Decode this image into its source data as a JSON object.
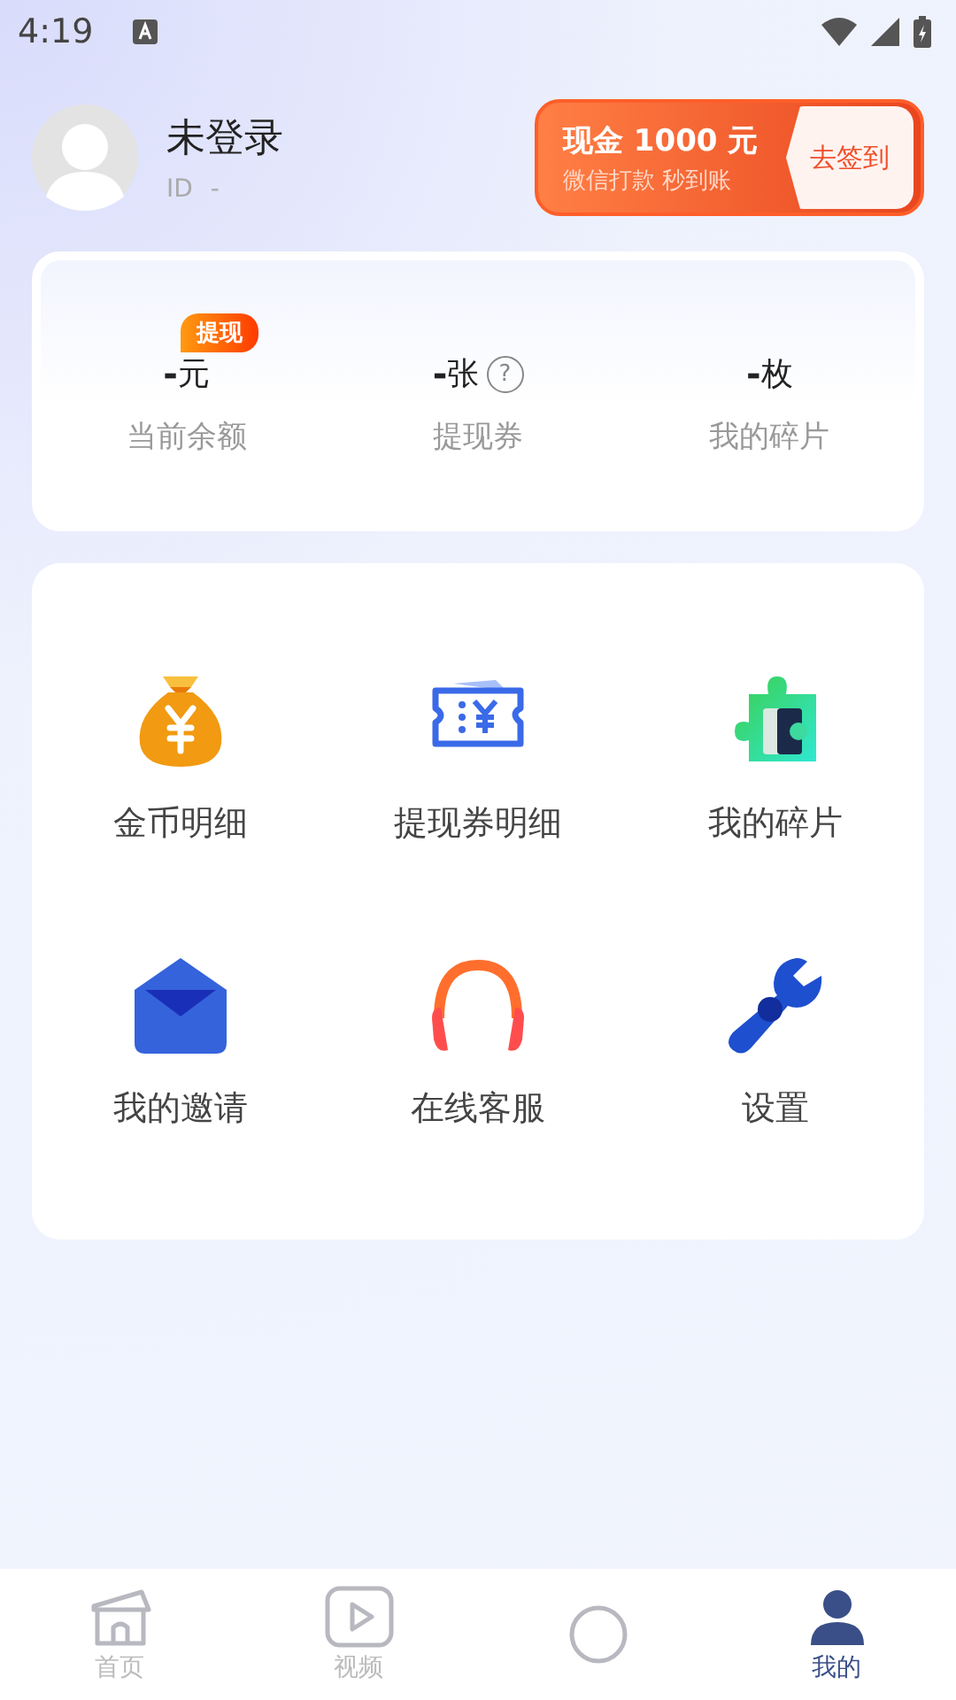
{
  "status_bar": {
    "time": "4:19"
  },
  "profile": {
    "name": "未登录",
    "id_label": "ID",
    "id_value": "-"
  },
  "promo": {
    "title": "现金 1000 元",
    "subtitle": "微信打款 秒到账",
    "button": "去签到"
  },
  "stats": [
    {
      "value": "-",
      "unit": "元",
      "label": "当前余额",
      "badge": "提现"
    },
    {
      "value": "-",
      "unit": "张",
      "label": "提现券",
      "help": "?"
    },
    {
      "value": "-",
      "unit": "枚",
      "label": "我的碎片"
    }
  ],
  "menu": [
    {
      "kind": "money-bag",
      "label": "金币明细"
    },
    {
      "kind": "ticket",
      "label": "提现券明细"
    },
    {
      "kind": "puzzle",
      "label": "我的碎片"
    },
    {
      "kind": "mail",
      "label": "我的邀请"
    },
    {
      "kind": "headset",
      "label": "在线客服"
    },
    {
      "kind": "wrench",
      "label": "设置"
    }
  ],
  "tabs": [
    {
      "kind": "home",
      "label": "首页",
      "selected": false
    },
    {
      "kind": "video",
      "label": "视频",
      "selected": false
    },
    {
      "kind": "circle",
      "selected": false
    },
    {
      "kind": "person",
      "label": "我的",
      "selected": true
    }
  ]
}
